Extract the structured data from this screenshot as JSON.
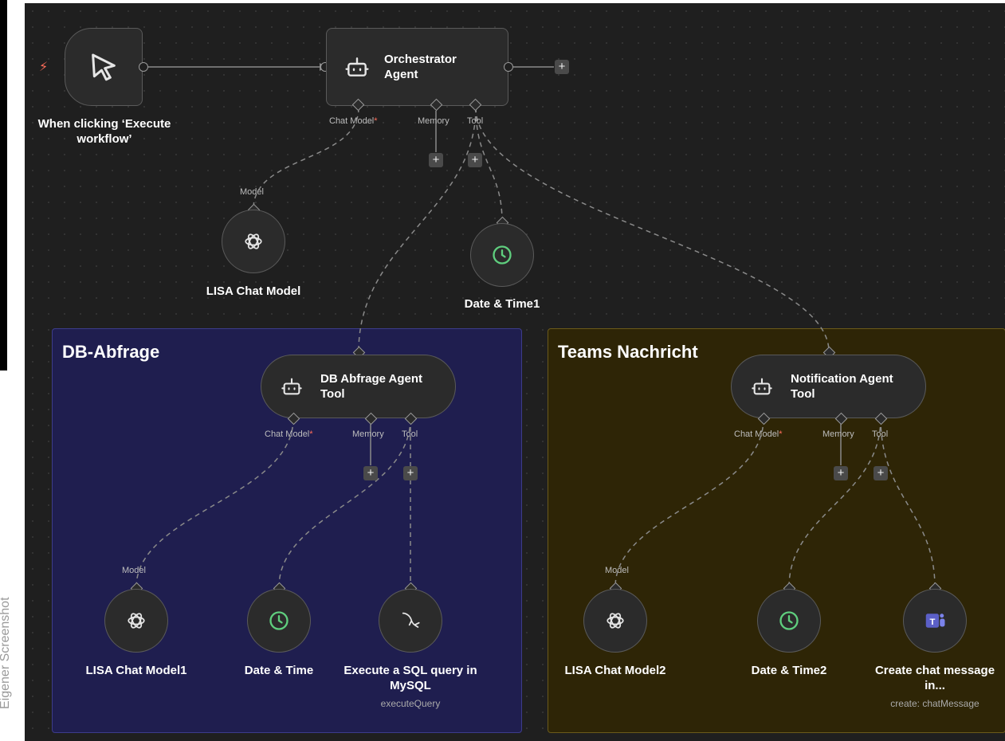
{
  "watermark": "Eigener Screenshot",
  "colors": {
    "canvas": "#1f1f1f",
    "sticky_blue": "#1f1e4f",
    "sticky_yellow": "#2e2506",
    "node": "#2b2b2b",
    "accent_green": "#5fce7e",
    "required": "#ff6d5a",
    "teams": "#5b5fc7"
  },
  "trigger": {
    "label": "When clicking ‘Execute workflow’",
    "icon": "cursor-icon"
  },
  "orchestrator": {
    "title": "Orchestrator Agent",
    "ports": {
      "chat_model": "Chat Model",
      "memory": "Memory",
      "tool": "Tool"
    }
  },
  "lisa_main": {
    "port": "Model",
    "label": "LISA Chat Model",
    "icon": "openai-icon"
  },
  "datetime_main": {
    "label": "Date & Time1",
    "icon": "clock-icon"
  },
  "sticky_db": {
    "title": "DB-Abfrage"
  },
  "sticky_teams": {
    "title": "Teams Nachricht"
  },
  "db_agent": {
    "title": "DB Abfrage Agent Tool",
    "ports": {
      "chat_model": "Chat Model",
      "memory": "Memory",
      "tool": "Tool"
    }
  },
  "db_lisa": {
    "port": "Model",
    "label": "LISA Chat Model1"
  },
  "db_datetime": {
    "label": "Date & Time"
  },
  "db_mysql": {
    "label": "Execute a SQL query in MySQL",
    "sub": "executeQuery",
    "icon": "mysql-dolphin-icon"
  },
  "notif_agent": {
    "title": "Notification Agent Tool",
    "ports": {
      "chat_model": "Chat Model",
      "memory": "Memory",
      "tool": "Tool"
    }
  },
  "notif_lisa": {
    "port": "Model",
    "label": "LISA Chat Model2"
  },
  "notif_datetime": {
    "label": "Date & Time2"
  },
  "notif_teams": {
    "label": "Create chat message in...",
    "sub": "create: chatMessage",
    "icon": "ms-teams-icon"
  }
}
